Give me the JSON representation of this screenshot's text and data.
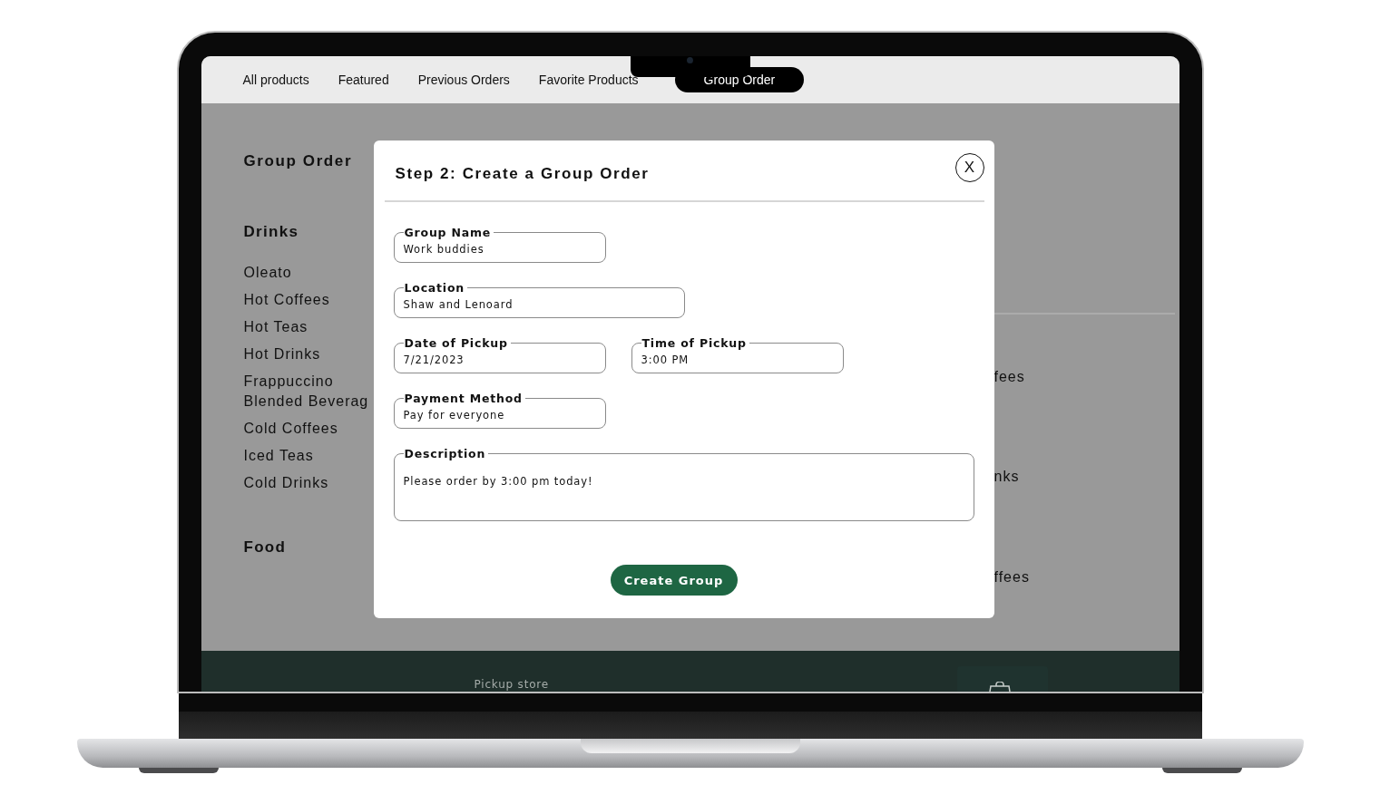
{
  "nav": {
    "tabs": [
      {
        "label": "All products",
        "selected": false
      },
      {
        "label": "Featured",
        "selected": false
      },
      {
        "label": "Previous Orders",
        "selected": false
      },
      {
        "label": "Favorite Products",
        "selected": false
      },
      {
        "label": "Group Order",
        "selected": true
      }
    ]
  },
  "sidebar": {
    "title": "Group Order",
    "sections": [
      {
        "heading": "Drinks",
        "items": [
          "Oleato",
          "Hot Coffees",
          "Hot Teas",
          "Hot Drinks",
          "Frappuccino Blended Beverag",
          "Cold Coffees",
          "Iced Teas",
          "Cold Drinks"
        ]
      },
      {
        "heading": "Food"
      }
    ]
  },
  "behind_dialog": {
    "texts": [
      "fees",
      "nks",
      "ffees"
    ]
  },
  "dialog": {
    "title": "Step 2: Create a Group Order",
    "close": "X",
    "rows": [
      [
        {
          "label": "Group Name",
          "value": "Work buddies",
          "kind": "short"
        }
      ],
      [
        {
          "label": "Location",
          "value": "Shaw and Lenoard",
          "kind": "medium"
        }
      ],
      [
        {
          "label": "Date of Pickup",
          "value": "7/21/2023",
          "kind": "short"
        },
        {
          "label": "Time of Pickup",
          "value": "3:00 PM",
          "kind": "short"
        }
      ],
      [
        {
          "label": "Payment Method",
          "value": "Pay for everyone",
          "kind": "short"
        }
      ],
      [
        {
          "label": "Description",
          "value": "Please order by 3:00 pm today!",
          "kind": "multiline"
        }
      ]
    ],
    "submit": "Create Group"
  },
  "footer": {
    "label": "Pickup store"
  }
}
